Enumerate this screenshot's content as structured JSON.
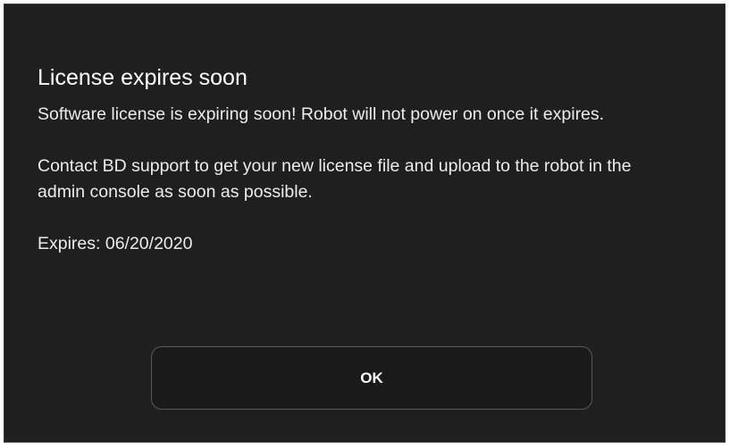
{
  "dialog": {
    "title": "License expires soon",
    "message_1": "Software license is expiring soon! Robot will not power on once it expires.",
    "message_2": "Contact BD support to get your new license file and upload to the robot in the admin console as soon as possible.",
    "expiry": "Expires: 06/20/2020",
    "ok_label": "OK"
  },
  "colors": {
    "background": "#1f1f1f",
    "text": "#f2f2f2",
    "button_border": "#5a5a5a"
  }
}
